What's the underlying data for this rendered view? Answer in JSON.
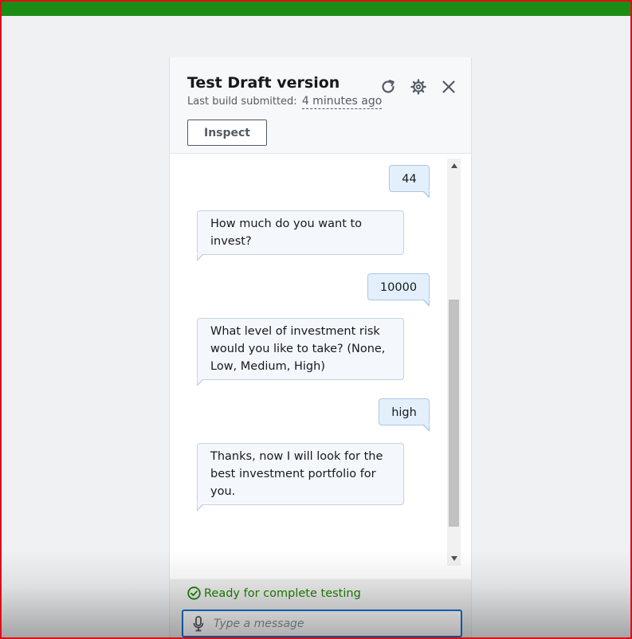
{
  "header": {
    "title": "Test Draft version",
    "build_label": "Last build submitted:",
    "build_time": "4 minutes ago",
    "inspect_label": "Inspect"
  },
  "icons": {
    "refresh": "refresh-icon",
    "settings": "gear-icon",
    "close": "close-icon",
    "status": "check-circle-icon",
    "mic": "microphone-icon"
  },
  "messages": [
    {
      "from": "user",
      "text": "44"
    },
    {
      "from": "bot",
      "text": "How much do you want to invest?"
    },
    {
      "from": "user",
      "text": "10000"
    },
    {
      "from": "bot",
      "text": "What level of investment risk would you like to take? (None, Low, Medium, High)"
    },
    {
      "from": "user",
      "text": "high"
    },
    {
      "from": "bot",
      "text": "Thanks, now I will look for the best investment portfolio for you."
    }
  ],
  "footer": {
    "status": "Ready for complete testing",
    "input_placeholder": "Type a message",
    "input_value": ""
  },
  "colors": {
    "top_bar": "#1d8c14",
    "status_green": "#1d8102",
    "input_focus": "#0972d3",
    "user_bubble": "#e3f0fb",
    "bot_bubble": "#f4f8fd"
  }
}
